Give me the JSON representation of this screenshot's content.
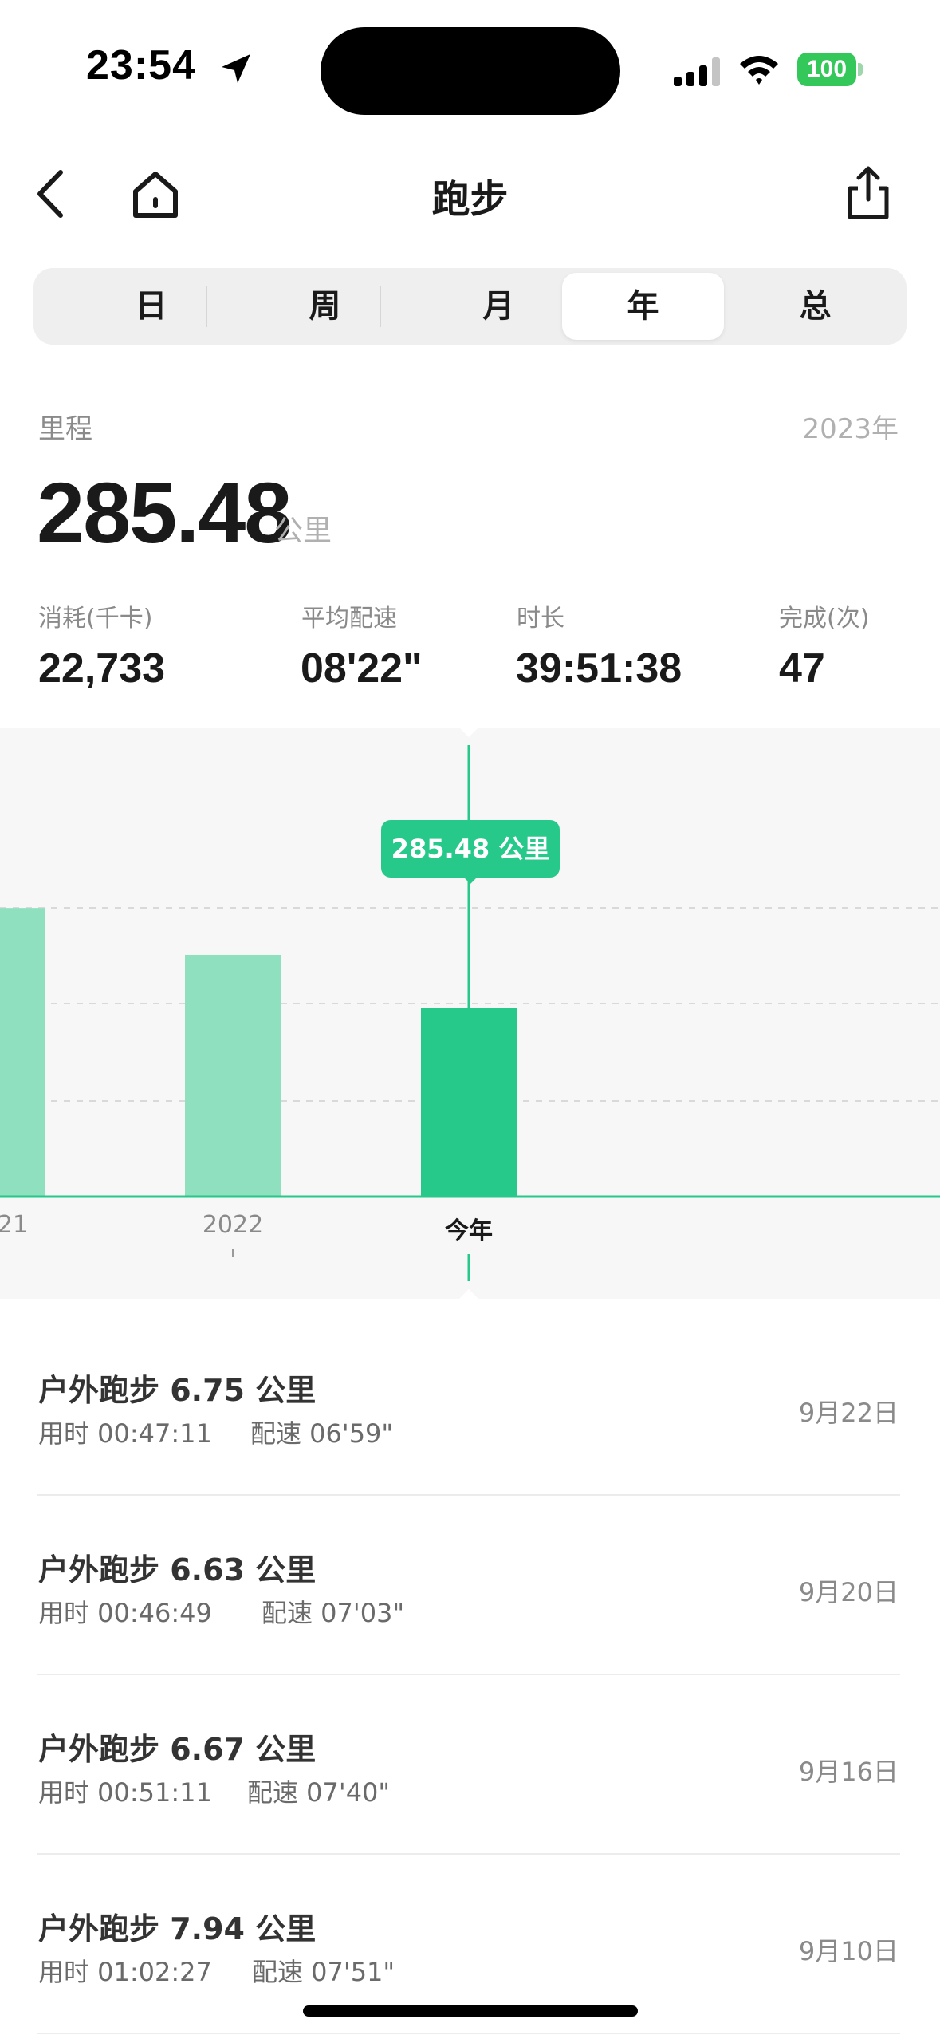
{
  "status_bar": {
    "time": "23:54",
    "battery": "100"
  },
  "nav": {
    "title": "跑步"
  },
  "tabs": [
    {
      "label": "日",
      "active": false
    },
    {
      "label": "周",
      "active": false
    },
    {
      "label": "月",
      "active": false
    },
    {
      "label": "年",
      "active": true
    },
    {
      "label": "总",
      "active": false
    }
  ],
  "summary": {
    "label": "里程",
    "year": "2023年",
    "distance": "285.48",
    "unit": "公里",
    "stats": [
      {
        "label": "消耗(千卡)",
        "value": "22,733"
      },
      {
        "label": "平均配速",
        "value": "08'22\""
      },
      {
        "label": "时长",
        "value": "39:51:38"
      },
      {
        "label": "完成(次)",
        "value": "47"
      }
    ]
  },
  "chart_data": {
    "type": "bar",
    "categories": [
      "21",
      "2022",
      "今年"
    ],
    "values": [
      437,
      366,
      285.48
    ],
    "selected_index": 2,
    "tooltip": "285.48 公里",
    "colors": {
      "selected": "#26c98a",
      "other": "#8fe0bf",
      "line": "#26c98a"
    },
    "grid": "dashed horizontal"
  },
  "runs": [
    {
      "title": "户外跑步 6.75 公里",
      "duration": "用时 00:47:11",
      "pace": "配速 06'59\"",
      "date": "9月22日"
    },
    {
      "title": "户外跑步 6.63 公里",
      "duration": "用时 00:46:49",
      "pace": "配速 07'03\"",
      "date": "9月20日"
    },
    {
      "title": "户外跑步 6.67 公里",
      "duration": "用时 00:51:11",
      "pace": "配速 07'40\"",
      "date": "9月16日"
    },
    {
      "title": "户外跑步 7.94 公里",
      "duration": "用时 01:02:27",
      "pace": "配速 07'51\"",
      "date": "9月10日"
    }
  ]
}
